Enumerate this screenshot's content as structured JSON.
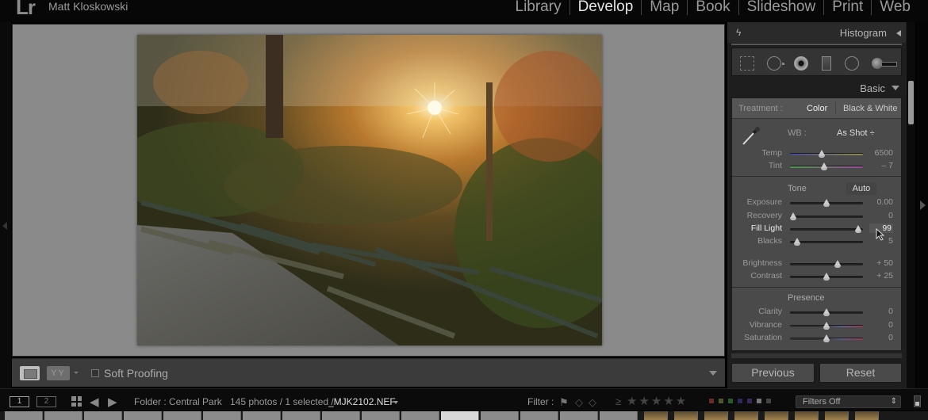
{
  "app": {
    "logo": "Lr",
    "identity_plate": "Matt Kloskowski"
  },
  "modules": [
    {
      "label": "Library",
      "active": false
    },
    {
      "label": "Develop",
      "active": true
    },
    {
      "label": "Map",
      "active": false
    },
    {
      "label": "Book",
      "active": false
    },
    {
      "label": "Slideshow",
      "active": false
    },
    {
      "label": "Print",
      "active": false
    },
    {
      "label": "Web",
      "active": false
    }
  ],
  "photo": {
    "description": "Park benches along a path in autumn with sunburst through trees"
  },
  "toolbar": {
    "view_mode_icon": "loupe-view-icon",
    "before_after_label": "YY",
    "soft_proofing_label": "Soft Proofing",
    "soft_proofing_checked": false
  },
  "right_panel": {
    "histogram_title": "Histogram",
    "tools": [
      "crop-overlay-icon",
      "spot-removal-icon",
      "red-eye-icon",
      "graduated-filter-icon",
      "radial-filter-icon",
      "adjustment-brush-icon"
    ],
    "basic_title": "Basic",
    "treatment": {
      "label": "Treatment :",
      "color": "Color",
      "bw": "Black & White",
      "selected": "Color"
    },
    "wb": {
      "label": "WB :",
      "value": "As Shot ÷"
    },
    "tone_label": "Tone",
    "auto_label": "Auto",
    "presence_label": "Presence",
    "sliders": {
      "temp": {
        "label": "Temp",
        "value": "6500",
        "position": 0.44
      },
      "tint": {
        "label": "Tint",
        "value": "– 7",
        "position": 0.47
      },
      "exposure": {
        "label": "Exposure",
        "value": "0.00",
        "position": 0.5
      },
      "recovery": {
        "label": "Recovery",
        "value": "0",
        "position": 0.04
      },
      "fill_light": {
        "label": "Fill Light",
        "value": "99",
        "position": 0.93
      },
      "blacks": {
        "label": "Blacks",
        "value": "5",
        "position": 0.1
      },
      "brightness": {
        "label": "Brightness",
        "value": "+ 50",
        "position": 0.65
      },
      "contrast": {
        "label": "Contrast",
        "value": "+ 25",
        "position": 0.5
      },
      "clarity": {
        "label": "Clarity",
        "value": "0",
        "position": 0.5
      },
      "vibrance": {
        "label": "Vibrance",
        "value": "0",
        "position": 0.5
      },
      "saturation": {
        "label": "Saturation",
        "value": "0",
        "position": 0.5
      }
    },
    "previous_label": "Previous",
    "reset_label": "Reset"
  },
  "filmstrip_bar": {
    "screen1": "1",
    "screen2": "2",
    "folder": "Folder : Central Park",
    "count": "145 photos / 1 selected /",
    "filename": "_MJK2102.NEF",
    "filter_label": "Filter :",
    "gte": "≥",
    "stars": "★★★★★",
    "color_labels": [
      "#6a2a2a",
      "#4a5a2a",
      "#2a5a2a",
      "#2a2a5a",
      "#3a2a5a",
      "#777777",
      "#444444"
    ],
    "filters_value": "Filters Off"
  }
}
